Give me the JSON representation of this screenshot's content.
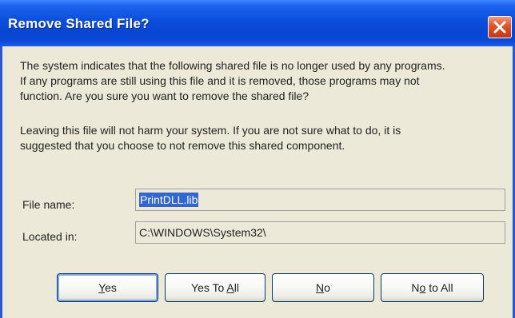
{
  "dialog": {
    "title": "Remove Shared File?",
    "close_icon": "close-x-icon",
    "message_line1": "The system indicates that the following shared file is no longer used by any programs.",
    "message_line2": "If any programs are still using this file and it is removed, those programs may not",
    "message_line3": "function.  Are you sure you want to remove the shared file?",
    "advice_line1": "Leaving this file will not harm your system.  If you are not sure what to do, it is",
    "advice_line2": "suggested that you choose to not remove this shared component."
  },
  "fields": {
    "file_name_label": "File name:",
    "file_name_value": "PrintDLL.lib",
    "located_in_label": "Located in:",
    "located_in_value": "C:\\WINDOWS\\System32\\"
  },
  "buttons": {
    "yes": {
      "before": "",
      "mnemonic": "Y",
      "after": "es"
    },
    "yes_to_all": {
      "before": "Yes To ",
      "mnemonic": "A",
      "after": "ll"
    },
    "no": {
      "before": "",
      "mnemonic": "N",
      "after": "o"
    },
    "no_to_all": {
      "before": "N",
      "mnemonic": "o",
      "after": " to All"
    }
  },
  "colors": {
    "titlebar": "#0a4fdc",
    "close_button": "#d2401c",
    "selection": "#3166d6",
    "dialog_background": "#ece9d8"
  }
}
